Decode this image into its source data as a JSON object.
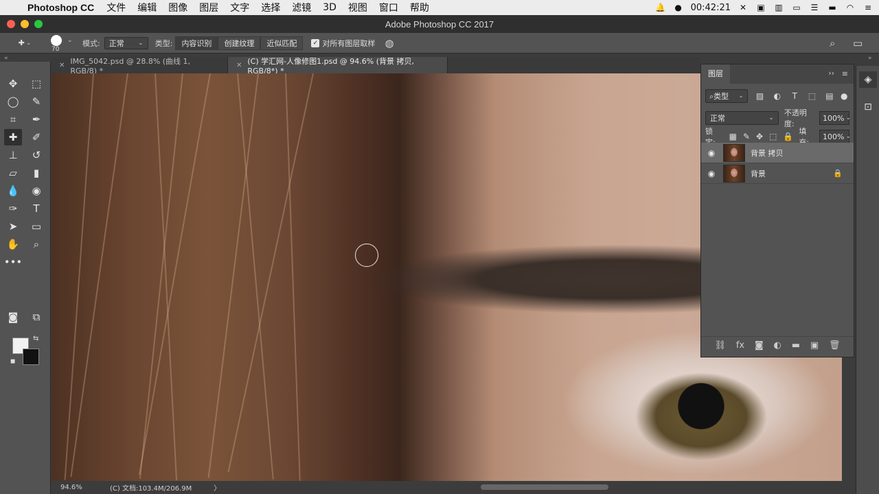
{
  "menubar": {
    "app_name": "Photoshop CC",
    "items": [
      "文件",
      "编辑",
      "图像",
      "图层",
      "文字",
      "选择",
      "滤镜",
      "3D",
      "视图",
      "窗口",
      "帮助"
    ],
    "clock": "00:42:21"
  },
  "window": {
    "title": "Adobe Photoshop CC 2017"
  },
  "options": {
    "brush_size": "70",
    "mode_label": "模式:",
    "mode_value": "正常",
    "type_label": "类型:",
    "type_buttons": [
      "内容识别",
      "创建纹理",
      "近似匹配"
    ],
    "sample_all_label": "对所有图层取样"
  },
  "tabs": [
    {
      "label": "IMG_5042.psd @ 28.8% (曲线 1, RGB/8) *"
    },
    {
      "label": "(C) 学汇网-人像修图1.psd @ 94.6% (背景 拷贝, RGB/8*) *"
    }
  ],
  "status": {
    "zoom": "94.6%",
    "doc_info": "(C) 文档:103.4M/206.9M",
    "arrow": "〉"
  },
  "layers_panel": {
    "tab_label": "图层",
    "filter_label": "类型",
    "blend_mode": "正常",
    "opacity_label": "不透明度:",
    "opacity_value": "100%",
    "lock_label": "锁定:",
    "fill_label": "填充:",
    "fill_value": "100%",
    "layers": [
      {
        "name": "背景 拷贝",
        "selected": true
      },
      {
        "name": "背景",
        "selected": false,
        "locked": true
      }
    ]
  }
}
